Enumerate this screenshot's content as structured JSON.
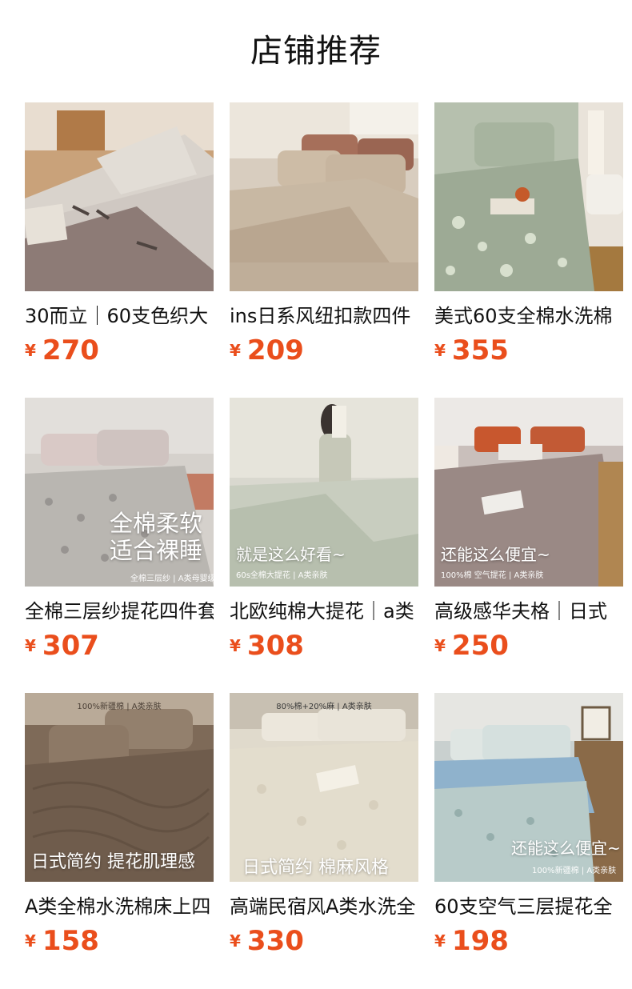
{
  "section_title": "店铺推荐",
  "currency": "¥",
  "products": [
    {
      "name": "30而立｜60支色织大",
      "price": "270"
    },
    {
      "name": "ins日系风纽扣款四件",
      "price": "209"
    },
    {
      "name": "美式60支全棉水洗棉",
      "price": "355"
    },
    {
      "name": "全棉三层纱提花四件套",
      "price": "307",
      "overlay": [
        "全棉柔软",
        "适合裸睡"
      ],
      "overlay_small": "全棉三层纱 | A类母婴级"
    },
    {
      "name": "北欧纯棉大提花｜a类",
      "price": "308",
      "overlay": [
        "就是这么好看~"
      ],
      "overlay_small": "60s全棉大提花 | A类亲肤"
    },
    {
      "name": "高级感华夫格｜日式",
      "price": "250",
      "overlay": [
        "还能这么便宜~"
      ],
      "overlay_small": "100%棉 空气提花 | A类亲肤"
    },
    {
      "name": "A类全棉水洗棉床上四",
      "price": "158",
      "overlay": [
        "日式简约 提花肌理感"
      ],
      "overlay_top": "100%新疆棉 | A类亲肤"
    },
    {
      "name": "高端民宿风A类水洗全",
      "price": "330",
      "overlay": [
        "日式简约 棉麻风格"
      ],
      "overlay_top": "80%棉+20%麻 | A类亲肤"
    },
    {
      "name": "60支空气三层提花全",
      "price": "198",
      "overlay": [
        "还能这么便宜~"
      ],
      "overlay_small": "100%新疆棉 | A类亲肤"
    }
  ]
}
